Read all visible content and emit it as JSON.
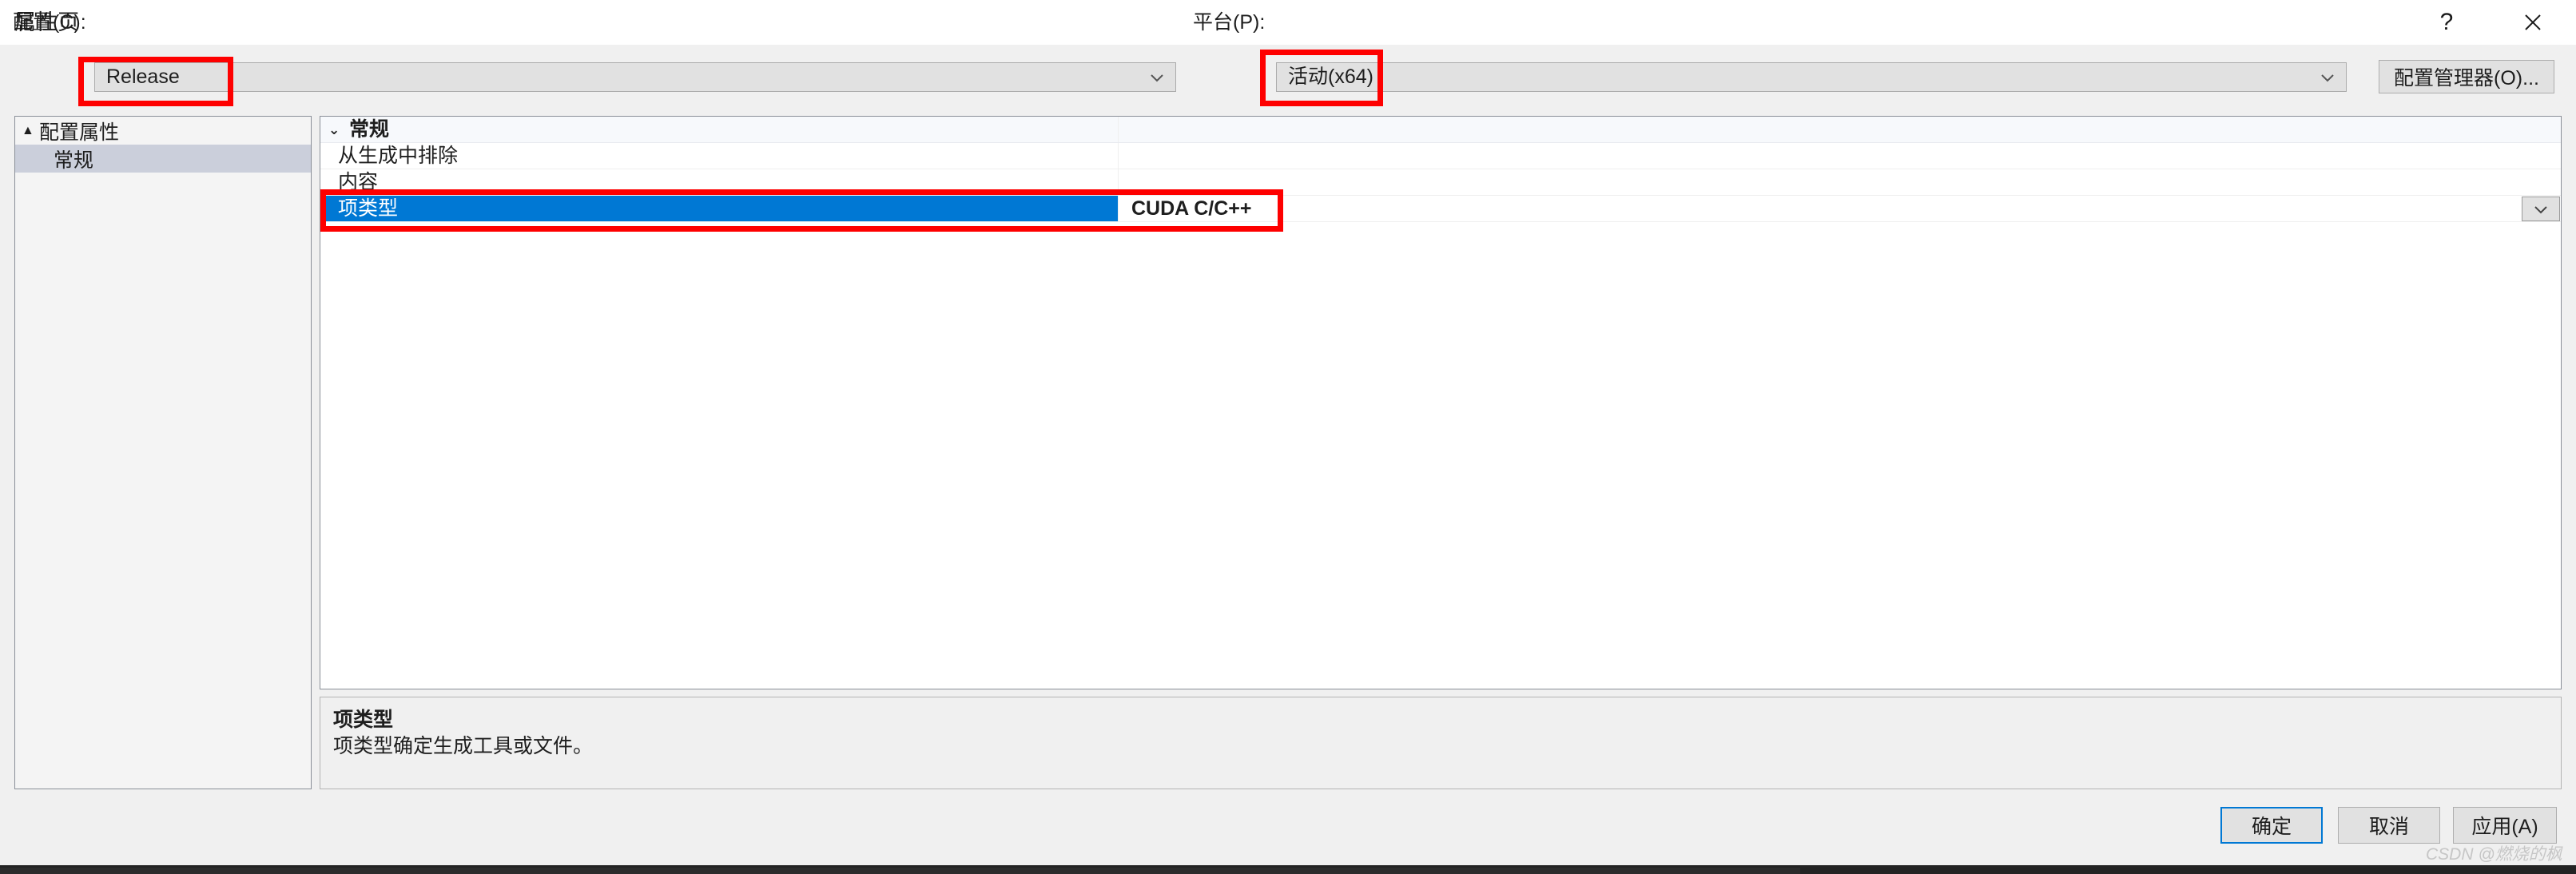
{
  "window": {
    "title": "属性页",
    "help_icon": "question-mark-icon",
    "close_icon": "close-icon"
  },
  "configbar": {
    "config_label": "配置(C):",
    "config_value": "Release",
    "platform_label": "平台(P):",
    "platform_value": "活动(x64)",
    "config_manager_label": "配置管理器(O)...",
    "dropdown_icon": "chevron-down-icon"
  },
  "tree": {
    "items": [
      {
        "label": "配置属性",
        "level": 0,
        "expanded": true,
        "selected": false,
        "arrow": "▲"
      },
      {
        "label": "常规",
        "level": 1,
        "expanded": false,
        "selected": true,
        "arrow": ""
      }
    ]
  },
  "grid": {
    "rows": [
      {
        "name": "常规",
        "value": "",
        "group": true,
        "selected": false,
        "chevron": "⌄"
      },
      {
        "name": "从生成中排除",
        "value": "",
        "group": false,
        "selected": false
      },
      {
        "name": "内容",
        "value": "",
        "group": false,
        "selected": false
      },
      {
        "name": "项类型",
        "value": "CUDA C/C++",
        "group": false,
        "selected": true,
        "dropdown_icon": "chevron-down-icon"
      }
    ]
  },
  "description": {
    "title": "项类型",
    "body": "项类型确定生成工具或文件。"
  },
  "footer": {
    "ok_label": "确定",
    "cancel_label": "取消",
    "apply_label": "应用(A)"
  },
  "watermark": {
    "text": "CSDN @燃烧的枫"
  },
  "colors": {
    "selection_blue": "#0078d4",
    "annotation_red": "#fe0000",
    "tree_selection": "#cbcfdb",
    "dialog_bg": "#f0f0f0"
  }
}
